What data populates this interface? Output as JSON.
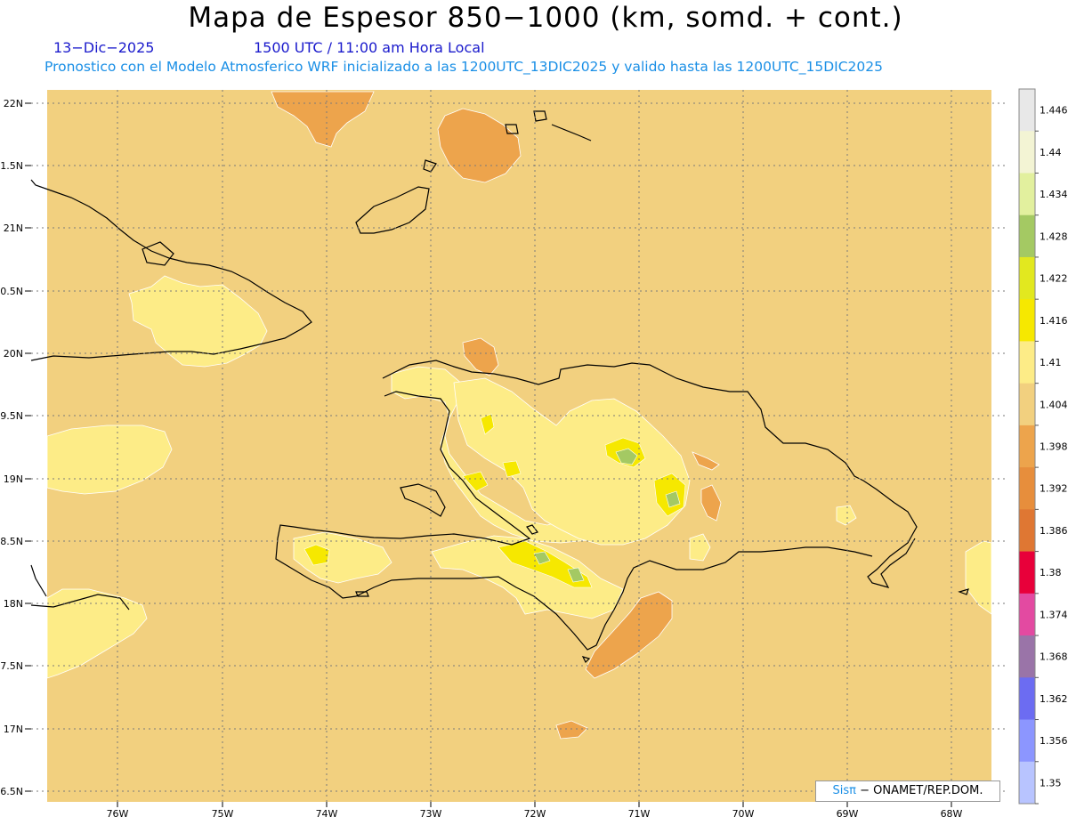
{
  "header": {
    "title": "Mapa de Espesor 850−1000 (km, somd. + cont.)",
    "date": "13−Dic−2025",
    "time": "1500 UTC / 11:00 am Hora Local",
    "description": "Pronostico con el Modelo Atmosferico WRF inicializado a las 1200UTC_13DIC2025 y valido hasta las  1200UTC_15DIC2025"
  },
  "axes": {
    "lat_labels": [
      "22N",
      "1.5N",
      "21N",
      "0.5N",
      "20N",
      "9.5N",
      "19N",
      "8.5N",
      "18N",
      "7.5N",
      "17N",
      "6.5N"
    ],
    "lon_labels": [
      "76W",
      "75W",
      "74W",
      "73W",
      "72W",
      "71W",
      "70W",
      "69W",
      "68W"
    ]
  },
  "colorbar": {
    "labels": [
      "1.446",
      "1.44",
      "1.434",
      "1.428",
      "1.422",
      "1.416",
      "1.41",
      "1.404",
      "1.398",
      "1.392",
      "1.386",
      "1.38",
      "1.374",
      "1.368",
      "1.362",
      "1.356",
      "1.35"
    ],
    "colors": [
      "#e8e8e8",
      "#f3f4d4",
      "#e2f09e",
      "#a4c963",
      "#e2e81f",
      "#f6e800",
      "#fdec87",
      "#f2d07f",
      "#eda44c",
      "#e78e3c",
      "#df7733",
      "#e8003a",
      "#e34aa1",
      "#9a74a8",
      "#6c6cf2",
      "#8c96ff",
      "#b8c4ff"
    ]
  },
  "credit": {
    "sis": "Sisπ",
    "text": "− ONAMET/REP.DOM."
  }
}
